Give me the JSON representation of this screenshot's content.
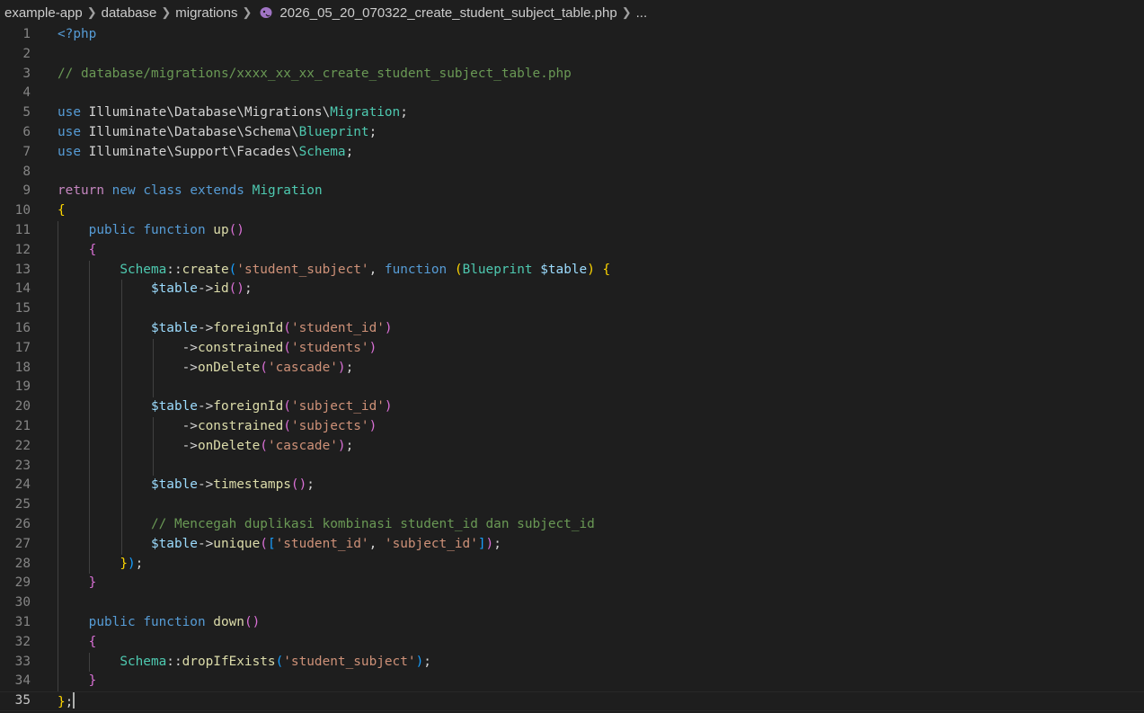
{
  "breadcrumb": {
    "items": [
      "example-app",
      "database",
      "migrations"
    ],
    "file": "2026_05_20_070322_create_student_subject_table.php",
    "more": "...",
    "file_icon": "php-elephant-icon"
  },
  "editor": {
    "language": "php",
    "active_line": 35,
    "lines": [
      [
        [
          "kw",
          "<?php"
        ]
      ],
      [],
      [
        [
          "cm",
          "// database/migrations/xxxx_xx_xx_create_student_subject_table.php"
        ]
      ],
      [],
      [
        [
          "kw",
          "use"
        ],
        [
          "pl",
          " Illuminate\\Database\\Migrations\\"
        ],
        [
          "ty",
          "Migration"
        ],
        [
          "pl",
          ";"
        ]
      ],
      [
        [
          "kw",
          "use"
        ],
        [
          "pl",
          " Illuminate\\Database\\Schema\\"
        ],
        [
          "ty",
          "Blueprint"
        ],
        [
          "pl",
          ";"
        ]
      ],
      [
        [
          "kw",
          "use"
        ],
        [
          "pl",
          " Illuminate\\Support\\Facades\\"
        ],
        [
          "ty",
          "Schema"
        ],
        [
          "pl",
          ";"
        ]
      ],
      [],
      [
        [
          "ctl",
          "return"
        ],
        [
          "pl",
          " "
        ],
        [
          "kw",
          "new"
        ],
        [
          "pl",
          " "
        ],
        [
          "kw",
          "class"
        ],
        [
          "pl",
          " "
        ],
        [
          "kw",
          "extends"
        ],
        [
          "pl",
          " "
        ],
        [
          "ty",
          "Migration"
        ]
      ],
      [
        [
          "b1",
          "{"
        ]
      ],
      [
        [
          "pl",
          "    "
        ],
        [
          "kw",
          "public"
        ],
        [
          "pl",
          " "
        ],
        [
          "kw",
          "function"
        ],
        [
          "pl",
          " "
        ],
        [
          "fn",
          "up"
        ],
        [
          "b2",
          "()"
        ]
      ],
      [
        [
          "pl",
          "    "
        ],
        [
          "b2",
          "{"
        ]
      ],
      [
        [
          "pl",
          "        "
        ],
        [
          "ty",
          "Schema"
        ],
        [
          "op",
          "::"
        ],
        [
          "fn",
          "create"
        ],
        [
          "b3",
          "("
        ],
        [
          "str",
          "'student_subject'"
        ],
        [
          "pl",
          ", "
        ],
        [
          "kw",
          "function"
        ],
        [
          "pl",
          " "
        ],
        [
          "b1",
          "("
        ],
        [
          "ty",
          "Blueprint"
        ],
        [
          "pl",
          " "
        ],
        [
          "var",
          "$table"
        ],
        [
          "b1",
          ")"
        ],
        [
          "pl",
          " "
        ],
        [
          "b1",
          "{"
        ]
      ],
      [
        [
          "pl",
          "            "
        ],
        [
          "var",
          "$table"
        ],
        [
          "op",
          "->"
        ],
        [
          "fn",
          "id"
        ],
        [
          "b2",
          "()"
        ],
        [
          "pl",
          ";"
        ]
      ],
      [],
      [
        [
          "pl",
          "            "
        ],
        [
          "var",
          "$table"
        ],
        [
          "op",
          "->"
        ],
        [
          "fn",
          "foreignId"
        ],
        [
          "b2",
          "("
        ],
        [
          "str",
          "'student_id'"
        ],
        [
          "b2",
          ")"
        ]
      ],
      [
        [
          "pl",
          "                "
        ],
        [
          "op",
          "->"
        ],
        [
          "fn",
          "constrained"
        ],
        [
          "b2",
          "("
        ],
        [
          "str",
          "'students'"
        ],
        [
          "b2",
          ")"
        ]
      ],
      [
        [
          "pl",
          "                "
        ],
        [
          "op",
          "->"
        ],
        [
          "fn",
          "onDelete"
        ],
        [
          "b2",
          "("
        ],
        [
          "str",
          "'cascade'"
        ],
        [
          "b2",
          ")"
        ],
        [
          "pl",
          ";"
        ]
      ],
      [],
      [
        [
          "pl",
          "            "
        ],
        [
          "var",
          "$table"
        ],
        [
          "op",
          "->"
        ],
        [
          "fn",
          "foreignId"
        ],
        [
          "b2",
          "("
        ],
        [
          "str",
          "'subject_id'"
        ],
        [
          "b2",
          ")"
        ]
      ],
      [
        [
          "pl",
          "                "
        ],
        [
          "op",
          "->"
        ],
        [
          "fn",
          "constrained"
        ],
        [
          "b2",
          "("
        ],
        [
          "str",
          "'subjects'"
        ],
        [
          "b2",
          ")"
        ]
      ],
      [
        [
          "pl",
          "                "
        ],
        [
          "op",
          "->"
        ],
        [
          "fn",
          "onDelete"
        ],
        [
          "b2",
          "("
        ],
        [
          "str",
          "'cascade'"
        ],
        [
          "b2",
          ")"
        ],
        [
          "pl",
          ";"
        ]
      ],
      [],
      [
        [
          "pl",
          "            "
        ],
        [
          "var",
          "$table"
        ],
        [
          "op",
          "->"
        ],
        [
          "fn",
          "timestamps"
        ],
        [
          "b2",
          "()"
        ],
        [
          "pl",
          ";"
        ]
      ],
      [],
      [
        [
          "pl",
          "            "
        ],
        [
          "cm",
          "// Mencegah duplikasi kombinasi student_id dan subject_id"
        ]
      ],
      [
        [
          "pl",
          "            "
        ],
        [
          "var",
          "$table"
        ],
        [
          "op",
          "->"
        ],
        [
          "fn",
          "unique"
        ],
        [
          "b2",
          "("
        ],
        [
          "b3",
          "["
        ],
        [
          "str",
          "'student_id'"
        ],
        [
          "pl",
          ", "
        ],
        [
          "str",
          "'subject_id'"
        ],
        [
          "b3",
          "]"
        ],
        [
          "b2",
          ")"
        ],
        [
          "pl",
          ";"
        ]
      ],
      [
        [
          "pl",
          "        "
        ],
        [
          "b1",
          "}"
        ],
        [
          "b3",
          ")"
        ],
        [
          "pl",
          ";"
        ]
      ],
      [
        [
          "pl",
          "    "
        ],
        [
          "b2",
          "}"
        ]
      ],
      [],
      [
        [
          "pl",
          "    "
        ],
        [
          "kw",
          "public"
        ],
        [
          "pl",
          " "
        ],
        [
          "kw",
          "function"
        ],
        [
          "pl",
          " "
        ],
        [
          "fn",
          "down"
        ],
        [
          "b2",
          "()"
        ]
      ],
      [
        [
          "pl",
          "    "
        ],
        [
          "b2",
          "{"
        ]
      ],
      [
        [
          "pl",
          "        "
        ],
        [
          "ty",
          "Schema"
        ],
        [
          "op",
          "::"
        ],
        [
          "fn",
          "dropIfExists"
        ],
        [
          "b3",
          "("
        ],
        [
          "str",
          "'student_subject'"
        ],
        [
          "b3",
          ")"
        ],
        [
          "pl",
          ";"
        ]
      ],
      [
        [
          "pl",
          "    "
        ],
        [
          "b2",
          "}"
        ]
      ],
      [
        [
          "b1",
          "}"
        ],
        [
          "pl",
          ";"
        ]
      ]
    ]
  }
}
